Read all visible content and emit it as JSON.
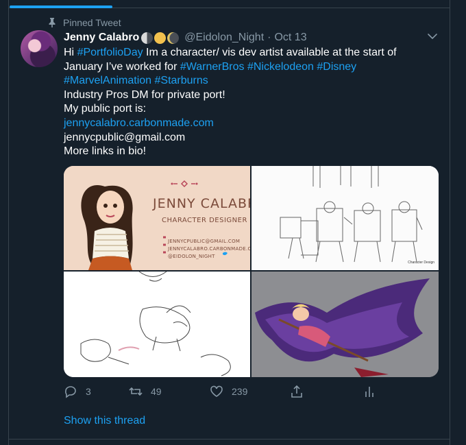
{
  "pinned_label": "Pinned Tweet",
  "author": {
    "display_name": "Jenny Calabro",
    "handle": "@Eidolon_Night",
    "separator": "·",
    "date": "Oct 13"
  },
  "tweet": {
    "line1": {
      "a": "Hi ",
      "b": "#PortfolioDay",
      "c": " Im a character/ vis dev artist available at the start of"
    },
    "line2": {
      "a": "January I’ve worked for ",
      "b": "#WarnerBros",
      "c": " ",
      "d": "#Nickelodeon",
      "e": " ",
      "f": "#Disney"
    },
    "line3": {
      "a": "#MarvelAnimation",
      "b": " ",
      "c": "#Starburns"
    },
    "line4": "Industry Pros DM for private port!",
    "line5": "My public port is:",
    "line6": "jennycalabro.carbonmade.com",
    "line7": "jennycpublic@gmail.com",
    "line8": "More links in bio!"
  },
  "media": {
    "card_name": "JENNY CALABRO",
    "card_role": "CHARACTER DESIGNER",
    "card_email": "JENNYCPUBLIC@GMAIL.COM",
    "card_site": "JENNYCALABRO.CARBONMADE.COM",
    "card_social": "@EIDOLON_NIGHT",
    "caption_2": "Character Design"
  },
  "actions": {
    "replies": "3",
    "retweets": "49",
    "likes": "239"
  },
  "show_thread": "Show this thread",
  "colors": {
    "background": "#15202b",
    "link": "#1da1f2",
    "muted": "#8899a6",
    "border": "#38444d"
  },
  "icons": [
    "pin-icon",
    "caret-down-icon",
    "reply-icon",
    "retweet-icon",
    "like-icon",
    "share-icon",
    "analytics-icon"
  ]
}
